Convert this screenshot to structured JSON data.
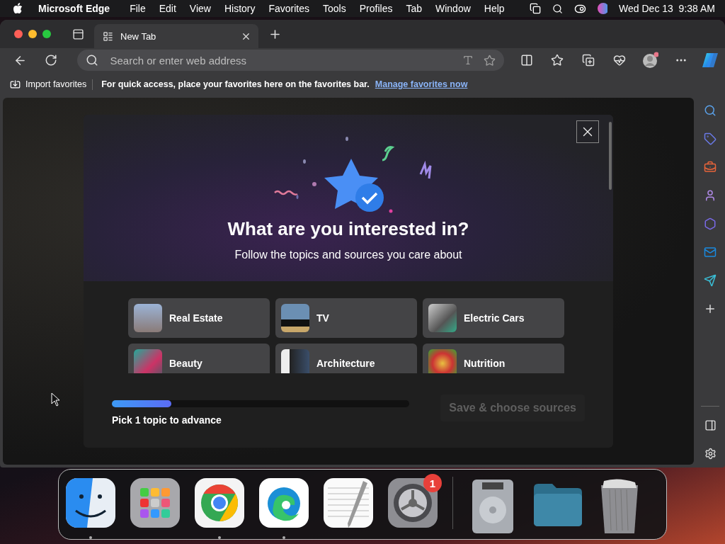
{
  "menubar": {
    "app_name": "Microsoft Edge",
    "menus": [
      "File",
      "Edit",
      "View",
      "History",
      "Favorites",
      "Tools",
      "Profiles",
      "Tab",
      "Window",
      "Help"
    ],
    "clock": "Wed Dec 13  9:38 AM"
  },
  "tabs": [
    {
      "label": "New Tab",
      "selected": true
    }
  ],
  "address_bar": {
    "placeholder": "Search or enter web address"
  },
  "favorites_bar": {
    "import_label": "Import favorites",
    "message": "For quick access, place your favorites here on the favorites bar.",
    "link": "Manage favorites now"
  },
  "dialog": {
    "title": "What are you interested in?",
    "subtitle": "Follow the topics and sources you care about",
    "topics": [
      {
        "label": "Real Estate",
        "selected": false
      },
      {
        "label": "TV",
        "selected": false
      },
      {
        "label": "Electric Cars",
        "selected": false
      },
      {
        "label": "Beauty",
        "selected": false
      },
      {
        "label": "Architecture",
        "selected": false
      },
      {
        "label": "Nutrition",
        "selected": false
      }
    ],
    "progress": {
      "level": 0.2,
      "caption": "Pick 1 topic to advance"
    },
    "button": {
      "label": "Save & choose sources",
      "disabled": true
    }
  },
  "dock": {
    "apps": [
      {
        "kind": "finder",
        "running": true
      },
      {
        "kind": "launchpad",
        "running": false
      },
      {
        "kind": "chrome",
        "running": true
      },
      {
        "kind": "edge",
        "running": true
      },
      {
        "kind": "textedit",
        "running": false
      },
      {
        "kind": "settings",
        "running": false,
        "badge": "1"
      }
    ],
    "others": [
      {
        "kind": "disk",
        "running": false
      },
      {
        "kind": "folder",
        "running": false
      },
      {
        "kind": "trash",
        "running": false
      }
    ]
  }
}
